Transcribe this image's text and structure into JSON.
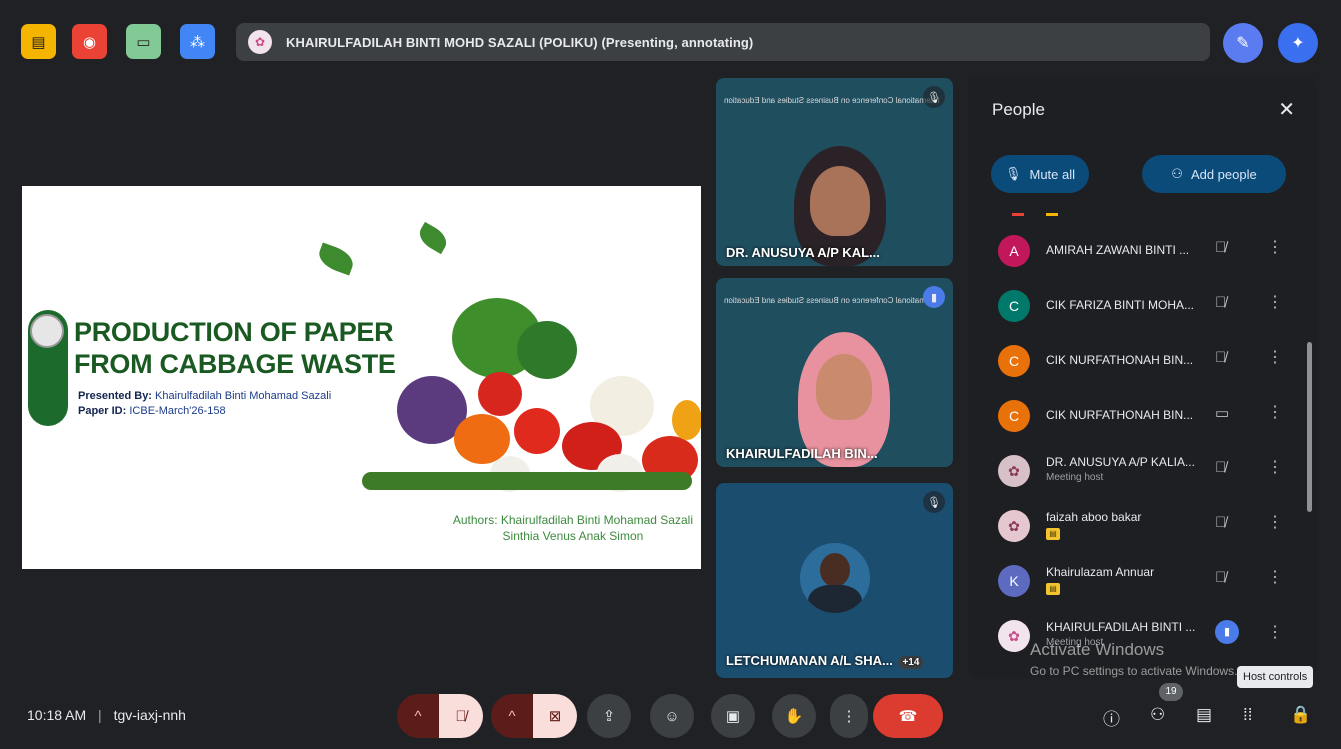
{
  "topbar": {
    "presenter_text": "KHAIRULFADILAH BINTI MOHD SAZALI (POLIKU) (Presenting, annotating)",
    "buttons": [
      {
        "icon": "whiteboard-icon",
        "color": "#f4b400"
      },
      {
        "icon": "record-icon",
        "color": "#ea4335"
      },
      {
        "icon": "companion-icon",
        "color": "#81c995"
      },
      {
        "icon": "breakout-icon",
        "color": "#4285f4"
      }
    ],
    "right_buttons": [
      {
        "icon": "annotate-pen-icon",
        "color": "#5b7cf0"
      },
      {
        "icon": "gemini-spark-icon",
        "color": "#3a6ff0"
      }
    ]
  },
  "slide": {
    "title_line1": "PRODUCTION OF PAPER",
    "title_line2": "FROM CABBAGE WASTE",
    "presented_by_label": "Presented By:",
    "presented_by": "Khairulfadilah Binti Mohamad Sazali",
    "paper_id_label": "Paper ID:",
    "paper_id": "ICBE-March'26-158",
    "authors_line1": "Authors: Khairulfadilah Binti Mohamad Sazali",
    "authors_line2": "Sinthia Venus Anak Simon"
  },
  "tiles": [
    {
      "name": "DR. ANUSUYA A/P KAL...",
      "mic": "mic-off-icon"
    },
    {
      "name": "KHAIRULFADILAH BIN...",
      "mic": "speaking-icon"
    },
    {
      "name": "LETCHUMANAN A/L SHA...",
      "extra": "+14",
      "mic": "mic-off-icon"
    }
  ],
  "people_panel": {
    "title": "People",
    "mute_all": "Mute all",
    "add_people": "Add people",
    "participants": [
      {
        "initial": "A",
        "color": "#c2185b",
        "name": "AMIRAH ZAWANI BINTI ...",
        "role": "",
        "state": "mic-off-icon"
      },
      {
        "initial": "C",
        "color": "#00796b",
        "name": "CIK FARIZA BINTI MOHA...",
        "role": "",
        "state": "mic-off-icon"
      },
      {
        "initial": "C",
        "color": "#e8710a",
        "name": "CIK NURFATHONAH BIN...",
        "role": "",
        "state": "mic-off-icon"
      },
      {
        "initial": "C",
        "color": "#e8710a",
        "name": "CIK NURFATHONAH BIN...",
        "role": "",
        "state": "companion-icon"
      },
      {
        "initial": "",
        "color": "#d7c0c8",
        "name": "DR. ANUSUYA A/P KALIA...",
        "role": "Meeting host",
        "state": "mic-off-icon"
      },
      {
        "initial": "",
        "color": "#e5c7cf",
        "name": "faizah aboo bakar",
        "role": "",
        "badge": true,
        "state": "mic-off-icon"
      },
      {
        "initial": "K",
        "color": "#5c6bc0",
        "name": "Khairulazam Annuar",
        "role": "",
        "badge": true,
        "state": "mic-off-icon"
      },
      {
        "initial": "",
        "color": "#f1e4ec",
        "name": "KHAIRULFADILAH BINTI ...",
        "role": "Meeting host",
        "state": "speaking-icon"
      }
    ]
  },
  "bottombar": {
    "time": "10:18 AM",
    "separator": "|",
    "meeting_code": "tgv-iaxj-nnh",
    "people_count": "19",
    "tooltip": "Host controls"
  },
  "watermark": {
    "line1": "Activate Windows",
    "line2": "Go to PC settings to activate Windows."
  }
}
